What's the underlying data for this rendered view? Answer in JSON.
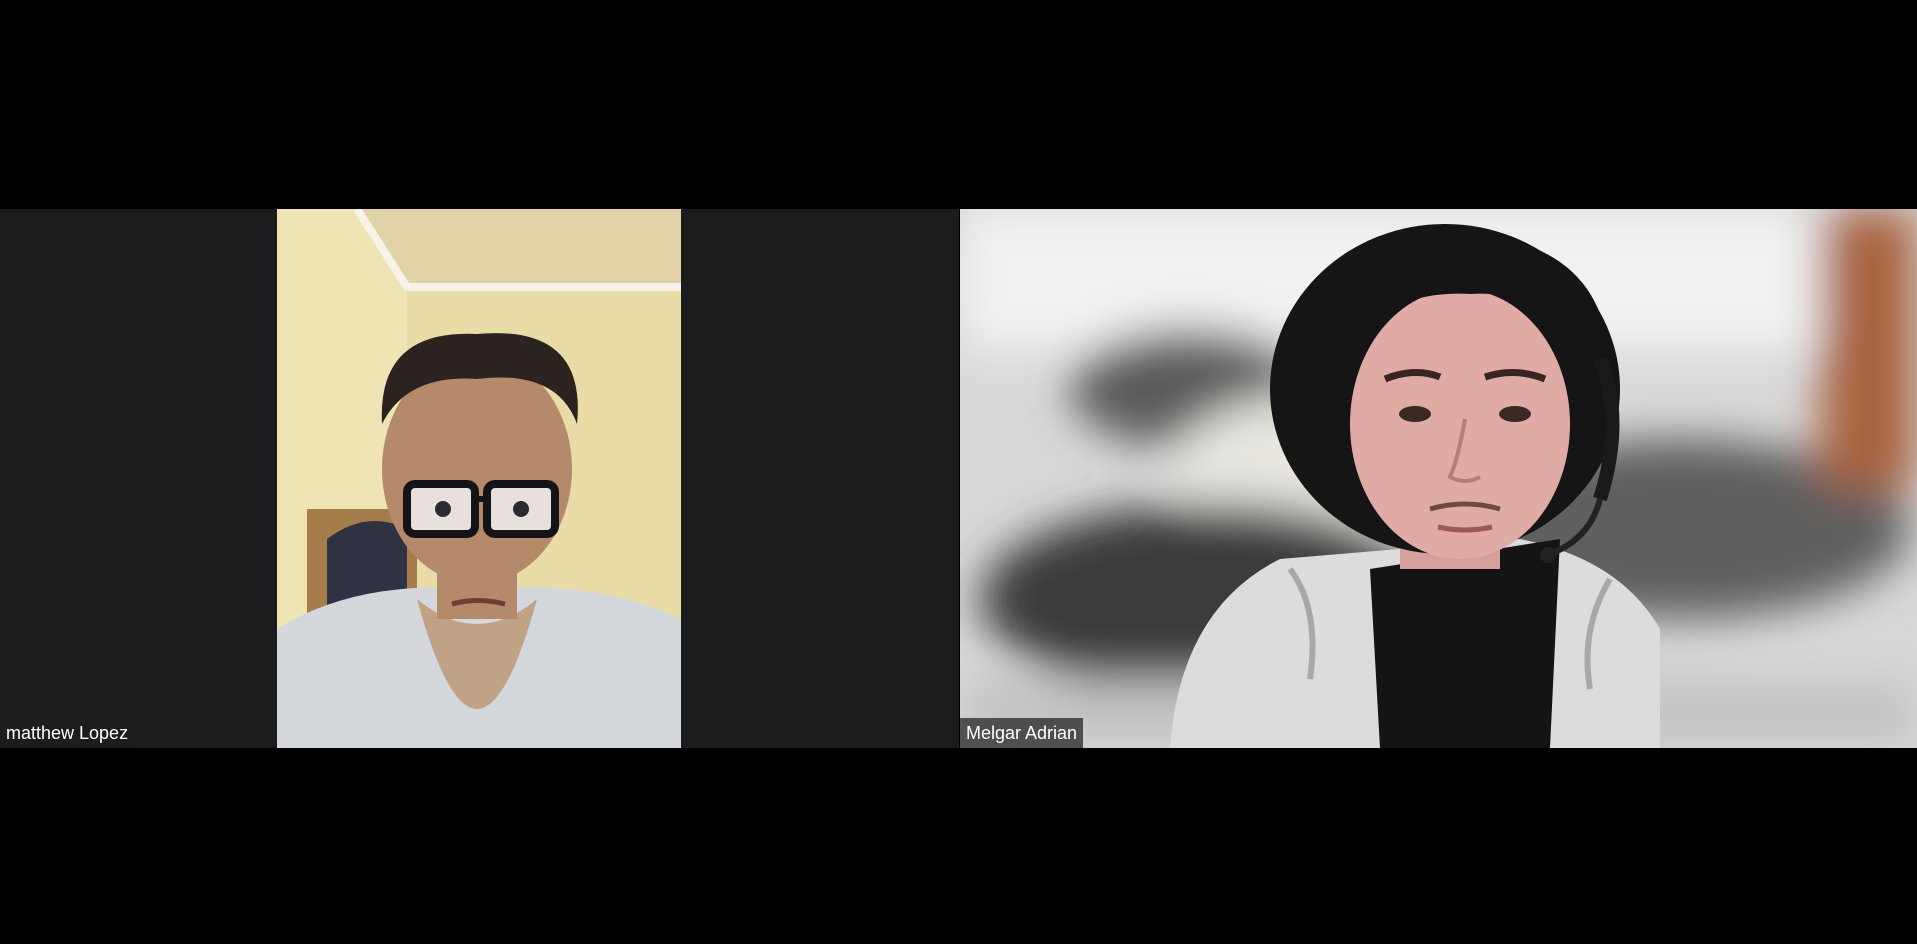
{
  "meeting": {
    "participants": [
      {
        "name": "matthew Lopez",
        "video_on": true
      },
      {
        "name": "Melgar Adrian",
        "video_on": true
      }
    ]
  },
  "colors": {
    "background": "#000000",
    "tile_background": "#1c1c1e",
    "name_tag_background": "#1e1e1e",
    "name_tag_text": "#ffffff"
  }
}
